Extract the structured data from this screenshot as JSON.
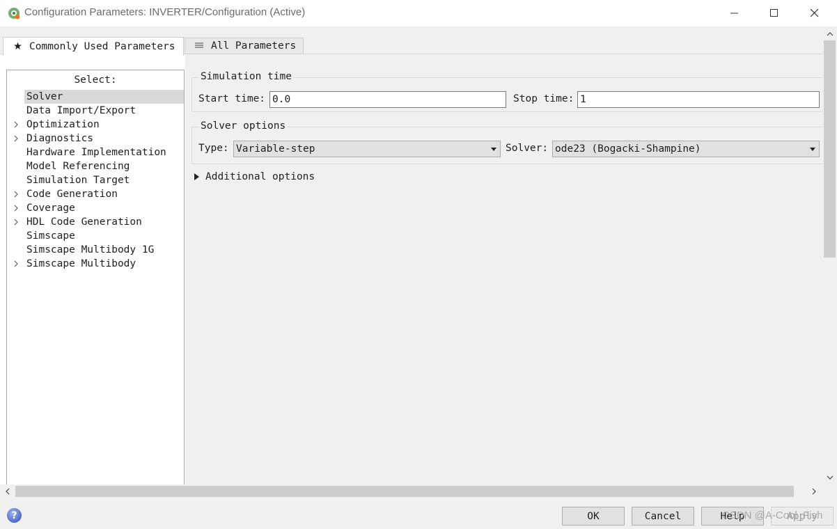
{
  "window": {
    "title": "Configuration Parameters: INVERTER/Configuration (Active)"
  },
  "tabs": [
    {
      "label": "Commonly Used Parameters",
      "icon": "star-icon",
      "active": true
    },
    {
      "label": "All Parameters",
      "icon": "list-icon",
      "active": false
    }
  ],
  "tree": {
    "header": "Select:",
    "items": [
      {
        "label": "Solver",
        "expandable": false,
        "selected": true
      },
      {
        "label": "Data Import/Export",
        "expandable": false
      },
      {
        "label": "Optimization",
        "expandable": true
      },
      {
        "label": "Diagnostics",
        "expandable": true
      },
      {
        "label": "Hardware Implementation",
        "expandable": false
      },
      {
        "label": "Model Referencing",
        "expandable": false
      },
      {
        "label": "Simulation Target",
        "expandable": false
      },
      {
        "label": "Code Generation",
        "expandable": true
      },
      {
        "label": "Coverage",
        "expandable": true
      },
      {
        "label": "HDL Code Generation",
        "expandable": true
      },
      {
        "label": "Simscape",
        "expandable": false
      },
      {
        "label": "Simscape Multibody 1G",
        "expandable": false
      },
      {
        "label": "Simscape Multibody",
        "expandable": true
      }
    ]
  },
  "simulation_time": {
    "title": "Simulation time",
    "start_label": "Start time:",
    "start_value": "0.0",
    "stop_label": "Stop time:",
    "stop_value": "1"
  },
  "solver_options": {
    "title": "Solver options",
    "type_label": "Type:",
    "type_value": "Variable-step",
    "solver_label": "Solver:",
    "solver_value": "ode23 (Bogacki-Shampine)"
  },
  "additional_options": "Additional options",
  "buttons": {
    "ok": "OK",
    "cancel": "Cancel",
    "help": "Help",
    "apply": "Apply"
  },
  "watermark": "CSDN @A-Cool_Fish",
  "colors": {
    "selection": "#d9d9d9",
    "panel_bg": "#f0f0f0",
    "button_bg": "#e1e1e1"
  }
}
